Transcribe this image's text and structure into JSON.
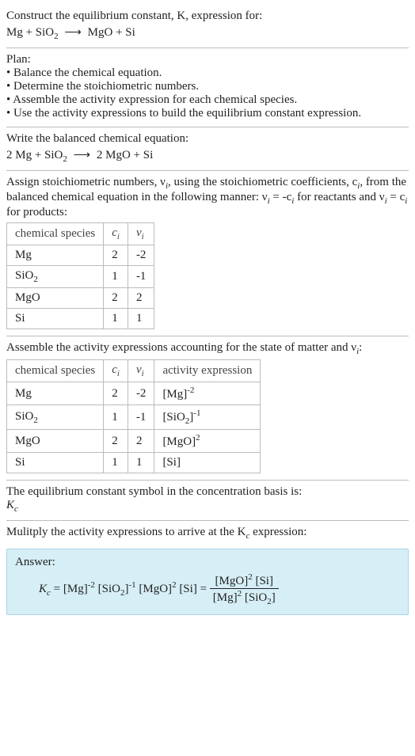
{
  "intro": {
    "line1": "Construct the equilibrium constant, K, expression for:",
    "equation_left": "Mg + SiO",
    "equation_sub": "2",
    "equation_right": "MgO + Si",
    "arrow": "⟶"
  },
  "plan": {
    "heading": "Plan:",
    "items": [
      "• Balance the chemical equation.",
      "• Determine the stoichiometric numbers.",
      "• Assemble the activity expression for each chemical species.",
      "• Use the activity expressions to build the equilibrium constant expression."
    ]
  },
  "balanced": {
    "heading": "Write the balanced chemical equation:",
    "left1": "2 Mg + SiO",
    "left_sub": "2",
    "right": "2 MgO + Si",
    "arrow": "⟶"
  },
  "stoich": {
    "text1": "Assign stoichiometric numbers, ν",
    "text2": ", using the stoichiometric coefficients, c",
    "text3": ", from the balanced chemical equation in the following manner: ν",
    "text4": " = -c",
    "text5": " for reactants and ν",
    "text6": " = c",
    "text7": " for products:",
    "sub_i": "i",
    "table1": {
      "h1": "chemical species",
      "h2": "c",
      "h3": "ν",
      "rows": [
        {
          "sp": "Mg",
          "c": "2",
          "v": "-2"
        },
        {
          "sp": "SiO",
          "sp_sub": "2",
          "c": "1",
          "v": "-1"
        },
        {
          "sp": "MgO",
          "c": "2",
          "v": "2"
        },
        {
          "sp": "Si",
          "c": "1",
          "v": "1"
        }
      ]
    }
  },
  "activity": {
    "heading": "Assemble the activity expressions accounting for the state of matter and ν",
    "heading_end": ":",
    "sub_i": "i",
    "table2": {
      "h1": "chemical species",
      "h2": "c",
      "h3": "ν",
      "h4": "activity expression",
      "rows": [
        {
          "sp": "Mg",
          "c": "2",
          "v": "-2",
          "act": "[Mg]",
          "act_sup": "-2"
        },
        {
          "sp": "SiO",
          "sp_sub": "2",
          "c": "1",
          "v": "-1",
          "act": "[SiO",
          "act_sub": "2",
          "act_end": "]",
          "act_sup": "-1"
        },
        {
          "sp": "MgO",
          "c": "2",
          "v": "2",
          "act": "[MgO]",
          "act_sup": "2"
        },
        {
          "sp": "Si",
          "c": "1",
          "v": "1",
          "act": "[Si]"
        }
      ]
    }
  },
  "symbol": {
    "line": "The equilibrium constant symbol in the concentration basis is:",
    "sym": "K",
    "sym_sub": "c"
  },
  "multiply": {
    "line": "Mulitply the activity expressions to arrive at the K",
    "line_sub": "c",
    "line_end": " expression:"
  },
  "answer": {
    "label": "Answer:",
    "K": "K",
    "Ksub": "c",
    "eq": " = [Mg]",
    "p1_sup": "-2",
    "p2": " [SiO",
    "p2_sub": "2",
    "p2_end": "]",
    "p2_sup": "-1",
    "p3": " [MgO]",
    "p3_sup": "2",
    "p4": " [Si] = ",
    "num": "[MgO]",
    "num_sup": "2",
    "num2": " [Si]",
    "den": "[Mg]",
    "den_sup": "2",
    "den2": " [SiO",
    "den2_sub": "2",
    "den2_end": "]"
  }
}
